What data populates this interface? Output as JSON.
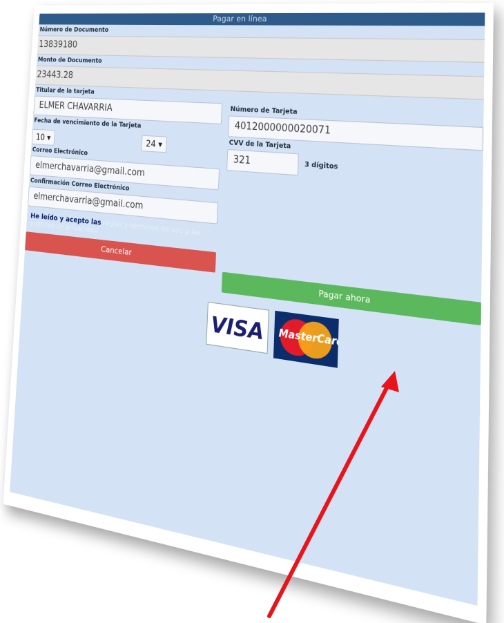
{
  "form": {
    "header_title": "Pagar en línea",
    "doc_number_label": "Número de Documento",
    "doc_number_value": "13839180",
    "amount_label": "Monto de Documento",
    "amount_value": "23443.28",
    "cardholder_label": "Titular de la tarjeta",
    "cardholder_value": "ELMER CHAVARRIA",
    "card_number_label": "Número de Tarjeta",
    "card_number_value": "4012000000020071",
    "expiry_label": "Fecha de vencimiento de la Tarjeta",
    "expiry_month": "10",
    "expiry_year": "24",
    "cvv_label": "CVV de la Tarjeta",
    "cvv_value": "321",
    "cvv_hint": "3 dígitos",
    "email_label": "Correo Electrónico",
    "email_value": "elmerchavarria@gmail.com",
    "email_confirm_label": "Confirmación Correo Electrónico",
    "email_confirm_value": "elmerchavarria@gmail.com",
    "terms_prefix": "He leído y acepto las",
    "terms_link": "reglas y términos de uso y las políticas de privacidad",
    "cancel_label": "Cancelar",
    "pay_label": "Pagar ahora",
    "visa_label": "VISA",
    "mastercard_label": "MasterCard"
  },
  "colors": {
    "panel_bg": "#d3e2f4",
    "header_bg": "#2f5b8a",
    "cancel_bg": "#d9534f",
    "pay_bg": "#5cb85c",
    "arrow": "#e8141b"
  }
}
